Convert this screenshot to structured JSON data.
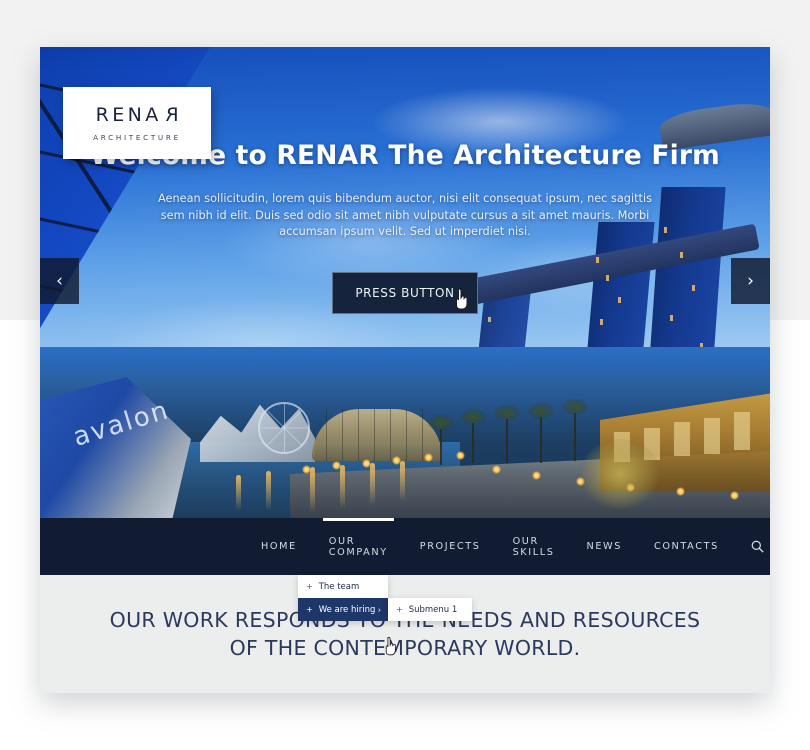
{
  "hero": {
    "title": "Welcome to RENAR The Architecture Firm",
    "paragraph": "Aenean sollicitudin, lorem quis bibendum auctor, nisi elit consequat ipsum, nec sagittis sem nibh id elit. Duis sed odio sit amet nibh vulputate cursus a sit amet mauris. Morbi accumsan ipsum velit. Sed ut imperdiet nisi.",
    "cta_label": "PRESS BUTTON",
    "prev_arrow": "‹",
    "next_arrow": "›"
  },
  "logo": {
    "name_left": "RENA",
    "name_reversed": "R",
    "subtitle": "ARCHITECTURE"
  },
  "nav": {
    "items": [
      {
        "label": "HOME",
        "active": false
      },
      {
        "label": "OUR COMPANY",
        "active": true
      },
      {
        "label": "PROJECTS",
        "active": false
      },
      {
        "label": "OUR SKILLS",
        "active": false
      },
      {
        "label": "NEWS",
        "active": false
      },
      {
        "label": "CONTACTS",
        "active": false
      }
    ],
    "search_icon": "search-icon"
  },
  "dropdown": {
    "items": [
      {
        "label": "The team",
        "marker": "+",
        "highlighted": false,
        "has_submenu": false
      },
      {
        "label": "We are hiring",
        "marker": "+",
        "highlighted": true,
        "has_submenu": true,
        "chevron": "›"
      }
    ],
    "submenu": [
      {
        "label": "Submenu 1",
        "marker": "+"
      }
    ]
  },
  "tagline": {
    "line1": "OUR WORK RESPONDS TO THE NEEDS AND RESOURCES",
    "line2": "OF THE CONTEMPORARY WORLD."
  },
  "colors": {
    "nav_bg": "#111c32",
    "dropdown_highlight": "#1e3668",
    "tagline_bg": "#eceded",
    "tagline_text": "#2b3a5c",
    "cta_bg": "#16233d",
    "page_bg": "#ffffff"
  }
}
